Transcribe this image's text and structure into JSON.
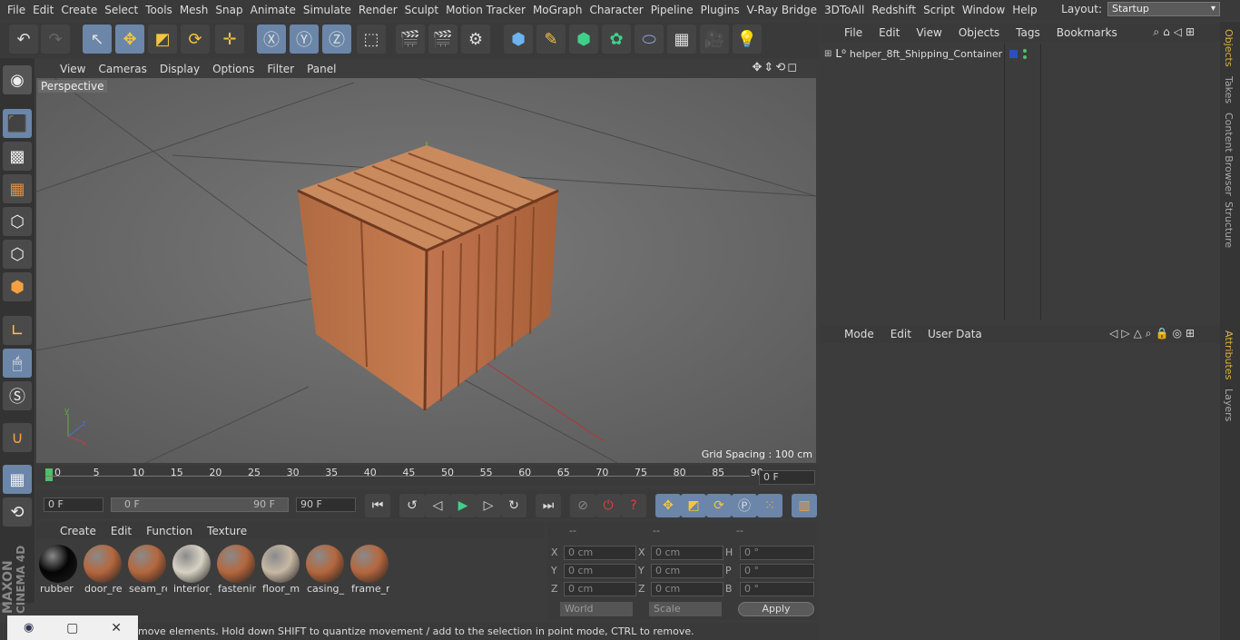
{
  "menubar": {
    "items": [
      "File",
      "Edit",
      "Create",
      "Select",
      "Tools",
      "Mesh",
      "Snap",
      "Animate",
      "Simulate",
      "Render",
      "Sculpt",
      "Motion Tracker",
      "MoGraph",
      "Character",
      "Pipeline",
      "Plugins",
      "V-Ray Bridge",
      "3DToAll",
      "Redshift",
      "Script",
      "Window",
      "Help"
    ],
    "layout_label": "Layout:",
    "layout_value": "Startup"
  },
  "viewport": {
    "menu": [
      "View",
      "Cameras",
      "Display",
      "Options",
      "Filter",
      "Panel"
    ],
    "label": "Perspective",
    "grid_spacing": "Grid Spacing : 100 cm"
  },
  "timeline": {
    "ticks": [
      "0",
      "5",
      "10",
      "15",
      "20",
      "25",
      "30",
      "35",
      "40",
      "45",
      "50",
      "55",
      "60",
      "65",
      "70",
      "75",
      "80",
      "85",
      "90"
    ],
    "current_frame": "0 F"
  },
  "transport": {
    "start_field": "0 F",
    "range_start": "0 F",
    "range_end": "90 F",
    "end_field": "90 F"
  },
  "materials": {
    "menu": [
      "Create",
      "Edit",
      "Function",
      "Texture"
    ],
    "items": [
      {
        "label": "rubber",
        "color": "#050505"
      },
      {
        "label": "door_re",
        "color": "#b5673e"
      },
      {
        "label": "seam_re",
        "color": "#b5673e"
      },
      {
        "label": "interior_",
        "color": "#d8d2c4"
      },
      {
        "label": "fastenin",
        "color": "#b5673e"
      },
      {
        "label": "floor_m",
        "color": "#c8b8a4"
      },
      {
        "label": "casing_r",
        "color": "#b5673e"
      },
      {
        "label": "frame_re",
        "color": "#b5673e"
      }
    ]
  },
  "coords": {
    "headers": [
      "--",
      "--",
      "--"
    ],
    "rows": [
      {
        "a": "X",
        "av": "0 cm",
        "b": "X",
        "bv": "0 cm",
        "c": "H",
        "cv": "0 °"
      },
      {
        "a": "Y",
        "av": "0 cm",
        "b": "Y",
        "bv": "0 cm",
        "c": "P",
        "cv": "0 °"
      },
      {
        "a": "Z",
        "av": "0 cm",
        "b": "Z",
        "bv": "0 cm",
        "c": "B",
        "cv": "0 °"
      }
    ],
    "world": "World",
    "scale": "Scale",
    "apply": "Apply"
  },
  "objects": {
    "menu": [
      "File",
      "Edit",
      "View",
      "Objects",
      "Tags",
      "Bookmarks"
    ],
    "item": "helper_8ft_Shipping_Container"
  },
  "attributes": {
    "menu": [
      "Mode",
      "Edit",
      "User Data"
    ]
  },
  "righttabs": [
    "Objects",
    "Takes",
    "Content Browser",
    "Structure",
    "Attributes",
    "Layers"
  ],
  "status": "move elements. Hold down SHIFT to quantize movement / add to the selection in point mode, CTRL to remove.",
  "brand": {
    "line1": "MAXON",
    "line2": "CINEMA 4D"
  }
}
